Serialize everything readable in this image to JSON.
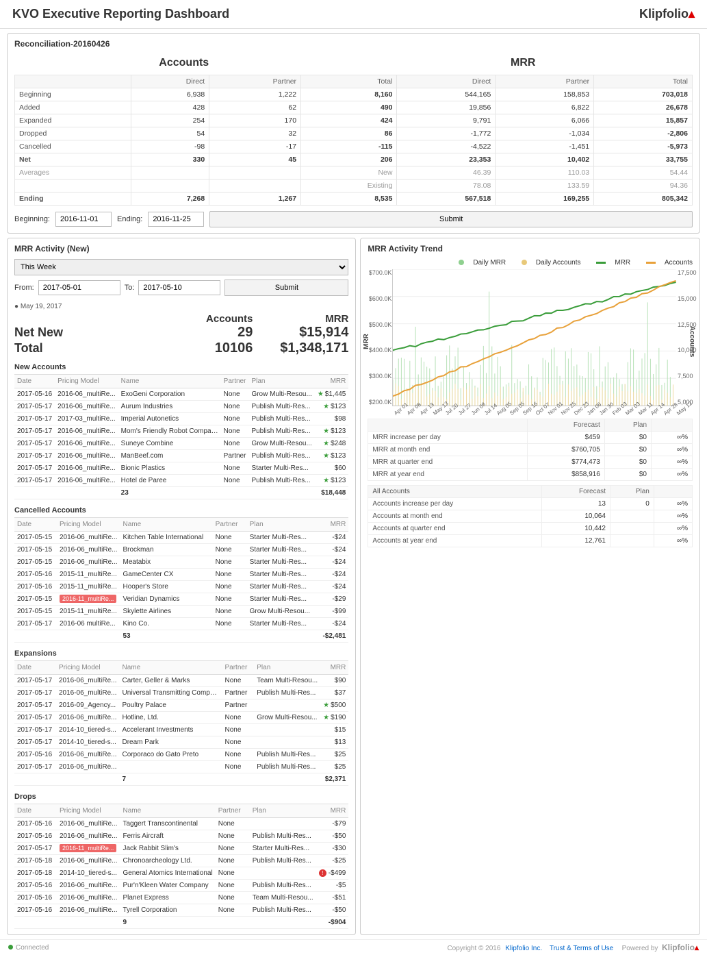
{
  "header": {
    "title": "KVO Executive Reporting Dashboard",
    "logo": "Klipfolio"
  },
  "reconciliation": {
    "title": "Reconciliation-20160426",
    "accounts_label": "Accounts",
    "mrr_label": "MRR",
    "cols": [
      "Direct",
      "Partner",
      "Total",
      "Direct",
      "Partner",
      "Total"
    ],
    "rows": [
      {
        "label": "Beginning",
        "v": [
          "6,938",
          "1,222",
          "8,160",
          "544,165",
          "158,853",
          "703,018"
        ],
        "bold_total": true
      },
      {
        "label": "Added",
        "v": [
          "428",
          "62",
          "490",
          "19,856",
          "6,822",
          "26,678"
        ],
        "bold_total": true
      },
      {
        "label": "Expanded",
        "v": [
          "254",
          "170",
          "424",
          "9,791",
          "6,066",
          "15,857"
        ],
        "bold_total": true
      },
      {
        "label": "Dropped",
        "v": [
          "54",
          "32",
          "86",
          "-1,772",
          "-1,034",
          "-2,806"
        ],
        "bold_total": true
      },
      {
        "label": "Cancelled",
        "v": [
          "-98",
          "-17",
          "-115",
          "-4,522",
          "-1,451",
          "-5,973"
        ],
        "bold_total": true
      },
      {
        "label": "Net",
        "v": [
          "330",
          "45",
          "206",
          "23,353",
          "10,402",
          "33,755"
        ],
        "bold": true
      },
      {
        "label": "Averages",
        "v": [
          "",
          "",
          "New",
          "46.39",
          "110.03",
          "54.44"
        ],
        "muted": true
      },
      {
        "label": "",
        "v": [
          "",
          "",
          "Existing",
          "78.08",
          "133.59",
          "94.36"
        ],
        "muted": true
      },
      {
        "label": "Ending",
        "v": [
          "7,268",
          "1,267",
          "8,535",
          "567,518",
          "169,255",
          "805,342"
        ],
        "bold": true
      }
    ],
    "begin_label": "Beginning:",
    "begin_val": "2016-11-01",
    "end_label": "Ending:",
    "end_val": "2016-11-25",
    "submit": "Submit"
  },
  "activity": {
    "title": "MRR Activity (New)",
    "range": "This Week",
    "from_label": "From:",
    "from_val": "2017-05-01",
    "to_label": "To:",
    "to_val": "2017-05-10",
    "submit": "Submit",
    "date_chip": "May 19, 2017",
    "summary": {
      "head_accounts": "Accounts",
      "head_mrr": "MRR",
      "netnew_label": "Net New",
      "netnew_accounts": "29",
      "netnew_mrr": "$15,914",
      "total_label": "Total",
      "total_accounts": "10106",
      "total_mrr": "$1,348,171"
    },
    "cols": [
      "Date",
      "Pricing Model",
      "Name",
      "Partner",
      "Plan",
      "MRR"
    ],
    "new_label": "New Accounts",
    "new_rows": [
      {
        "d": "2017-05-16",
        "pm": "2016-06_multiRe...",
        "n": "ExoGeni Corporation",
        "p": "None",
        "pl": "Grow Multi-Resou...",
        "m": "$1,445",
        "star": true
      },
      {
        "d": "2017-05-17",
        "pm": "2016-06_multiRe...",
        "n": "Aurum Industries",
        "p": "None",
        "pl": "Publish Multi-Res...",
        "m": "$123",
        "star": true
      },
      {
        "d": "2017-05-17",
        "pm": "2017-03_multiRe...",
        "n": "Imperial Autonetics",
        "p": "None",
        "pl": "Publish Multi-Res...",
        "m": "$98"
      },
      {
        "d": "2017-05-17",
        "pm": "2016-06_multiRe...",
        "n": "Mom's Friendly Robot Company",
        "p": "None",
        "pl": "Publish Multi-Res...",
        "m": "$123",
        "star": true
      },
      {
        "d": "2017-05-17",
        "pm": "2016-06_multiRe...",
        "n": "Suneye Combine",
        "p": "None",
        "pl": "Grow Multi-Resou...",
        "m": "$248",
        "star": true
      },
      {
        "d": "2017-05-17",
        "pm": "2016-06_multiRe...",
        "n": "ManBeef.com",
        "p": "Partner",
        "pl": "Publish Multi-Res...",
        "m": "$123",
        "star": true
      },
      {
        "d": "2017-05-17",
        "pm": "2016-06_multiRe...",
        "n": "Bionic Plastics",
        "p": "None",
        "pl": "Starter Multi-Res...",
        "m": "$60"
      },
      {
        "d": "2017-05-17",
        "pm": "2016-06_multiRe...",
        "n": "Hotel de Paree",
        "p": "None",
        "pl": "Publish Multi-Res...",
        "m": "$123",
        "star": true
      }
    ],
    "new_total_count": "23",
    "new_total_mrr": "$18,448",
    "cancel_label": "Cancelled Accounts",
    "cancel_rows": [
      {
        "d": "2017-05-15",
        "pm": "2016-06_multiRe...",
        "n": "Kitchen Table International",
        "p": "None",
        "pl": "Starter Multi-Res...",
        "m": "-$24"
      },
      {
        "d": "2017-05-15",
        "pm": "2016-06_multiRe...",
        "n": "Brockman",
        "p": "None",
        "pl": "Starter Multi-Res...",
        "m": "-$24"
      },
      {
        "d": "2017-05-15",
        "pm": "2016-06_multiRe...",
        "n": "Meatabix",
        "p": "None",
        "pl": "Starter Multi-Res...",
        "m": "-$24"
      },
      {
        "d": "2017-05-16",
        "pm": "2015-11_multiRe...",
        "n": "GameCenter CX",
        "p": "None",
        "pl": "Starter Multi-Res...",
        "m": "-$24"
      },
      {
        "d": "2017-05-16",
        "pm": "2015-11_multiRe...",
        "n": "Hooper's Store",
        "p": "None",
        "pl": "Starter Multi-Res...",
        "m": "-$24"
      },
      {
        "d": "2017-05-15",
        "pm": "2016-11_multiRe...",
        "n": "Veridian Dynamics",
        "p": "None",
        "pl": "Starter Multi-Res...",
        "m": "-$29",
        "red": true
      },
      {
        "d": "2017-05-15",
        "pm": "2015-11_multiRe...",
        "n": "Skylette Airlines",
        "p": "None",
        "pl": "Grow Multi-Resou...",
        "m": "-$99"
      },
      {
        "d": "2017-05-17",
        "pm": "2016-06 multiRe...",
        "n": "Kino Co.",
        "p": "None",
        "pl": "Starter Multi-Res...",
        "m": "-$24"
      }
    ],
    "cancel_total_count": "53",
    "cancel_total_mrr": "-$2,481",
    "exp_label": "Expansions",
    "exp_rows": [
      {
        "d": "2017-05-17",
        "pm": "2016-06_multiRe...",
        "n": "Carter, Geller & Marks",
        "p": "None",
        "pl": "Team Multi-Resou...",
        "m": "$90"
      },
      {
        "d": "2017-05-17",
        "pm": "2016-06_multiRe...",
        "n": "Universal Transmitting Company",
        "p": "Partner",
        "pl": "Publish Multi-Res...",
        "m": "$37"
      },
      {
        "d": "2017-05-17",
        "pm": "2016-09_Agency...",
        "n": "Poultry Palace",
        "p": "Partner",
        "pl": "",
        "m": "$500",
        "star": true
      },
      {
        "d": "2017-05-17",
        "pm": "2016-06_multiRe...",
        "n": "Hotline, Ltd.",
        "p": "None",
        "pl": "Grow Multi-Resou...",
        "m": "$190",
        "star": true
      },
      {
        "d": "2017-05-17",
        "pm": "2014-10_tiered-s...",
        "n": "Accelerant Investments",
        "p": "None",
        "pl": "",
        "m": "$15"
      },
      {
        "d": "2017-05-17",
        "pm": "2014-10_tiered-s...",
        "n": "Dream Park",
        "p": "None",
        "pl": "",
        "m": "$13"
      },
      {
        "d": "2017-05-16",
        "pm": "2016-06_multiRe...",
        "n": "Corporaco do Gato Preto",
        "p": "None",
        "pl": "Publish Multi-Res...",
        "m": "$25"
      },
      {
        "d": "2017-05-17",
        "pm": "2016-06_multiRe...",
        "n": "",
        "p": "None",
        "pl": "Publish Multi-Res...",
        "m": "$25"
      }
    ],
    "exp_total_count": "7",
    "exp_total_mrr": "$2,371",
    "drop_label": "Drops",
    "drop_rows": [
      {
        "d": "2017-05-16",
        "pm": "2016-06_multiRe...",
        "n": "Taggert Transcontinental",
        "p": "None",
        "pl": "",
        "m": "-$79"
      },
      {
        "d": "2017-05-16",
        "pm": "2016-06_multiRe...",
        "n": "Ferris Aircraft",
        "p": "None",
        "pl": "Publish Multi-Res...",
        "m": "-$50"
      },
      {
        "d": "2017-05-17",
        "pm": "2016-11_multiRe...",
        "n": "Jack Rabbit Slim's",
        "p": "None",
        "pl": "Starter Multi-Res...",
        "m": "-$30",
        "red": true
      },
      {
        "d": "2017-05-18",
        "pm": "2016-06_multiRe...",
        "n": "Chronoarcheology Ltd.",
        "p": "None",
        "pl": "Publish Multi-Res...",
        "m": "-$25"
      },
      {
        "d": "2017-05-18",
        "pm": "2014-10_tiered-s...",
        "n": "General Atomics International",
        "p": "None",
        "pl": "",
        "m": "-$499",
        "excl": true
      },
      {
        "d": "2017-05-16",
        "pm": "2016-06_multiRe...",
        "n": "Pur'n'Kleen Water Company",
        "p": "None",
        "pl": "Publish Multi-Res...",
        "m": "-$5"
      },
      {
        "d": "2017-05-16",
        "pm": "2016-06_multiRe...",
        "n": "Planet Express",
        "p": "None",
        "pl": "Team Multi-Resou...",
        "m": "-$51"
      },
      {
        "d": "2017-05-16",
        "pm": "2016-06_multiRe...",
        "n": "Tyrell Corporation",
        "p": "None",
        "pl": "Publish Multi-Res...",
        "m": "-$50"
      }
    ],
    "drop_total_count": "9",
    "drop_total_mrr": "-$904"
  },
  "trend": {
    "title": "MRR Activity Trend",
    "legend": {
      "daily_mrr": "Daily MRR",
      "daily_accounts": "Daily Accounts",
      "mrr": "MRR",
      "accounts": "Accounts"
    },
    "forecast_header": [
      "",
      "Forecast",
      "Plan",
      ""
    ],
    "mrr_rows": [
      [
        "MRR increase per day",
        "$459",
        "$0",
        "∞%"
      ],
      [
        "MRR at month end",
        "$760,705",
        "$0",
        "∞%"
      ],
      [
        "MRR at quarter end",
        "$774,473",
        "$0",
        "∞%"
      ],
      [
        "MRR at year end",
        "$858,916",
        "$0",
        "∞%"
      ]
    ],
    "acc_header": [
      "All Accounts",
      "Forecast",
      "Plan",
      ""
    ],
    "acc_rows": [
      [
        "Accounts increase per day",
        "13",
        "0",
        "∞%"
      ],
      [
        "Accounts at month end",
        "10,064",
        "",
        "∞%"
      ],
      [
        "Accounts at quarter end",
        "10,442",
        "",
        "∞%"
      ],
      [
        "Accounts at year end",
        "12,761",
        "",
        "∞%"
      ]
    ]
  },
  "chart_data": {
    "type": "line",
    "title": "MRR Activity Trend",
    "left_axis": {
      "label": "MRR",
      "ticks": [
        "$700.0K",
        "$600.0K",
        "$500.0K",
        "$400.0K",
        "$300.0K",
        "$200.0K"
      ]
    },
    "right_axis": {
      "label": "Accounts",
      "ticks": [
        "17,500",
        "15,000",
        "12,500",
        "10,000",
        "7,500",
        "5,000"
      ]
    },
    "x_ticks": [
      "Apr 01",
      "Apr 08",
      "Apr 13",
      "May 13",
      "Jul 20",
      "Jul 27",
      "Jun 08",
      "Jul 14",
      "Aug 05",
      "Sep 05",
      "Sep 16",
      "Oct 07",
      "Nov 01",
      "Nov 25",
      "Dec 23",
      "Jan 06",
      "Jan 30",
      "Feb 03",
      "Mar 03",
      "Mar 11",
      "Apr 14",
      "Apr 28",
      "May 12"
    ],
    "series": [
      {
        "name": "MRR",
        "color": "#3a9d3a",
        "approx_start": 400000,
        "approx_end": 720000
      },
      {
        "name": "Accounts",
        "color": "#e8a13a",
        "approx_start": 5500,
        "approx_end": 17000
      },
      {
        "name": "Daily MRR",
        "color": "#8fd08f",
        "style": "bars"
      },
      {
        "name": "Daily Accounts",
        "color": "#e8c97a",
        "style": "bars"
      }
    ]
  },
  "footer": {
    "connected": "Connected",
    "copyright": "Copyright © 2016",
    "klipfolio": "Klipfolio Inc.",
    "trust": "Trust & Terms of Use",
    "powered": "Powered by"
  }
}
